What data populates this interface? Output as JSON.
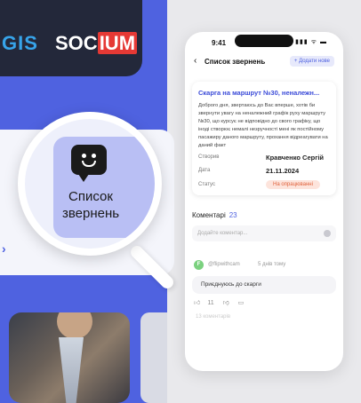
{
  "brand": {
    "part1": "GIS",
    "part2_prefix": "SOC",
    "part2_highlight": "IUM"
  },
  "magnifier": {
    "title": "Список звернень",
    "icon": "chat-smile-icon"
  },
  "phone": {
    "time": "9:41",
    "status_icons": "▮▮▮ ᯤ ▬",
    "nav": {
      "title": "Список звернень",
      "add_label": "+ Додати нове",
      "back_icon": "chevron-left-icon"
    },
    "ticket": {
      "title": "Скарга на маршрут №30, неналежн...",
      "body": "Доброго дня, звертаюсь до Вас вперше, хотів би звернути увагу на неналежний графік руху маршруту №30, що курсує не відповідно до свого графіку, що іноді створює немалі незручності мені як постійному пасажиру даного маршруту, прохання відреагувати на даний факт",
      "creator_label": "Створив",
      "creator_value": "Кравченко Сергій",
      "date_label": "Дата",
      "date_value": "21.11.2024",
      "status_label": "Статус",
      "status_value": "На опрацюванні"
    },
    "comments": {
      "label": "Коментарі",
      "count": "23",
      "input_placeholder": "Додайте коментар...",
      "items": [
        {
          "avatar_letter": "F",
          "user": "@flipwithcam",
          "time": "5 днів тому",
          "text": "Приєднуюсь до скарги",
          "likes": "11",
          "faded_text": "13 коментарів"
        }
      ]
    }
  },
  "colors": {
    "accent": "#4f62e0",
    "status": "#e0643e",
    "panel": "#4f62e0"
  }
}
